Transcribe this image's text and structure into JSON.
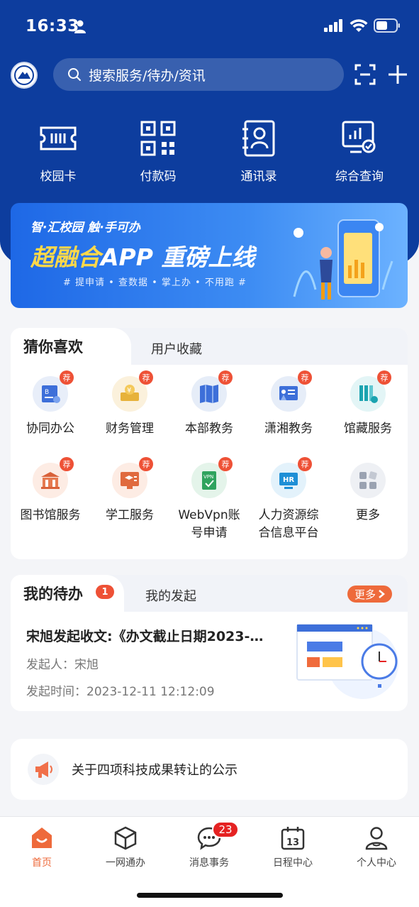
{
  "status_bar": {
    "time": "16:33"
  },
  "search": {
    "placeholder": "搜索服务/待办/资讯"
  },
  "quick_actions": [
    {
      "label": "校园卡",
      "icon": "campus-card-icon"
    },
    {
      "label": "付款码",
      "icon": "qr-code-icon"
    },
    {
      "label": "通讯录",
      "icon": "contacts-icon"
    },
    {
      "label": "综合查询",
      "icon": "query-icon"
    }
  ],
  "banner": {
    "top_text": "智·汇校园   触·手可办",
    "main_highlight": "超融合",
    "main_rest": "APP  重磅上线",
    "sub_text": "#  提申请 • 查数据 • 掌上办 • 不用跑  #"
  },
  "guess": {
    "tab_active": "猜你喜欢",
    "tab_inactive": "用户收藏",
    "badge": "荐",
    "apps": [
      {
        "label": "协同办公",
        "icon": "office-collab-icon",
        "color": "#e8eef9"
      },
      {
        "label": "财务管理",
        "icon": "finance-icon",
        "color": "#fbf1dc"
      },
      {
        "label": "本部教务",
        "icon": "book-map-icon",
        "color": "#e6edf8"
      },
      {
        "label": "潇湘教务",
        "icon": "teaching-board-icon",
        "color": "#e6edf8"
      },
      {
        "label": "馆藏服务",
        "icon": "library-shelf-icon",
        "color": "#e3f5f6"
      },
      {
        "label": "图书馆服务",
        "icon": "library-building-icon",
        "color": "#fdece4"
      },
      {
        "label": "学工服务",
        "icon": "student-affairs-icon",
        "color": "#fdece4"
      },
      {
        "label": "WebVpn账\n号申请",
        "icon": "vpn-icon",
        "color": "#e4f4ea"
      },
      {
        "label": "人力资源综\n合信息平台",
        "icon": "hr-icon",
        "color": "#e3f2fb"
      },
      {
        "label": "更多",
        "icon": "more-apps-icon",
        "color": "#eef0f4"
      }
    ]
  },
  "todo": {
    "tab_active": "我的待办",
    "count": "1",
    "tab_inactive": "我的发起",
    "more": "更多",
    "title": "宋旭发起收文:《办文截止日期2023-…",
    "initiator": "发起人：宋旭",
    "time": "发起时间：2023-12-11 12:12:09"
  },
  "notice": {
    "text": "关于四项科技成果转让的公示"
  },
  "bottom_nav": [
    {
      "label": "首页",
      "icon": "home-icon",
      "active": true
    },
    {
      "label": "一网通办",
      "icon": "cube-icon"
    },
    {
      "label": "消息事务",
      "icon": "message-icon",
      "badge": "23"
    },
    {
      "label": "日程中心",
      "icon": "calendar-icon",
      "day": "13"
    },
    {
      "label": "个人中心",
      "icon": "person-icon"
    }
  ],
  "colors": {
    "header": "#0d3d9e",
    "accent": "#ee6a3b",
    "badge": "#ee5136"
  }
}
